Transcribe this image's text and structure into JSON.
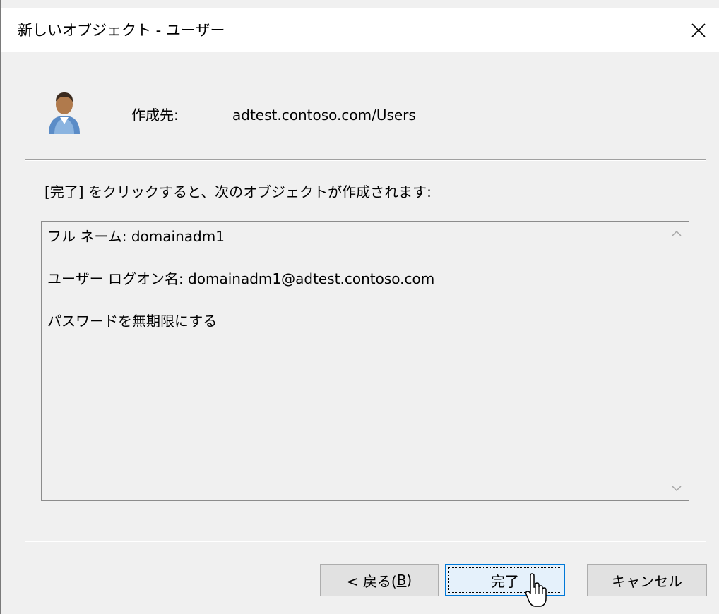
{
  "window": {
    "title": "新しいオブジェクト - ユーザー",
    "close_symbol": "✕"
  },
  "header": {
    "icon": "user-icon",
    "create_in_label": "作成先:",
    "create_in_path": "adtest.contoso.com/Users"
  },
  "instruction": "[完了] をクリックすると、次のオブジェクトが作成されます:",
  "summary": {
    "lines": [
      "フル ネーム: domainadm1",
      "ユーザー ログオン名: domainadm1@adtest.contoso.com",
      "パスワードを無期限にする"
    ]
  },
  "buttons": {
    "back_prefix": "< 戻る(",
    "back_accel": "B",
    "back_suffix": ")",
    "finish": "完了",
    "cancel": "キャンセル"
  },
  "colors": {
    "focus_border": "#0078d7",
    "dialog_bg": "#f0f0f0"
  }
}
